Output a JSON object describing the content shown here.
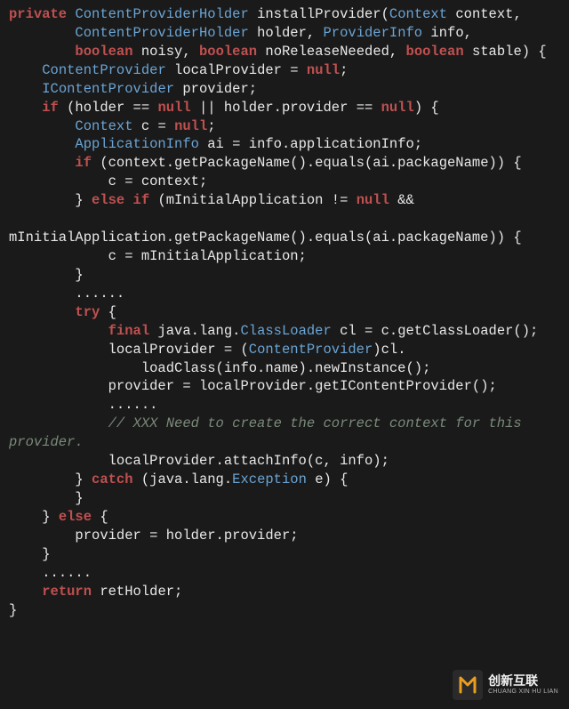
{
  "code": {
    "tokens": [
      {
        "c": "kw",
        "t": "private"
      },
      {
        "c": "txt",
        "t": " "
      },
      {
        "c": "type",
        "t": "ContentProviderHolder"
      },
      {
        "c": "txt",
        "t": " installProvider("
      },
      {
        "c": "type",
        "t": "Context"
      },
      {
        "c": "txt",
        "t": " context,\n"
      },
      {
        "c": "txt",
        "t": "        "
      },
      {
        "c": "type",
        "t": "ContentProviderHolder"
      },
      {
        "c": "txt",
        "t": " holder, "
      },
      {
        "c": "type",
        "t": "ProviderInfo"
      },
      {
        "c": "txt",
        "t": " info,\n"
      },
      {
        "c": "txt",
        "t": "        "
      },
      {
        "c": "kw",
        "t": "boolean"
      },
      {
        "c": "txt",
        "t": " noisy, "
      },
      {
        "c": "kw",
        "t": "boolean"
      },
      {
        "c": "txt",
        "t": " noReleaseNeeded, "
      },
      {
        "c": "kw",
        "t": "boolean"
      },
      {
        "c": "txt",
        "t": " stable) {\n"
      },
      {
        "c": "txt",
        "t": "    "
      },
      {
        "c": "type",
        "t": "ContentProvider"
      },
      {
        "c": "txt",
        "t": " localProvider = "
      },
      {
        "c": "kw",
        "t": "null"
      },
      {
        "c": "txt",
        "t": ";\n"
      },
      {
        "c": "txt",
        "t": "    "
      },
      {
        "c": "type",
        "t": "IContentProvider"
      },
      {
        "c": "txt",
        "t": " provider;\n"
      },
      {
        "c": "txt",
        "t": "    "
      },
      {
        "c": "kw",
        "t": "if"
      },
      {
        "c": "txt",
        "t": " (holder == "
      },
      {
        "c": "kw",
        "t": "null"
      },
      {
        "c": "txt",
        "t": " || holder.provider == "
      },
      {
        "c": "kw",
        "t": "null"
      },
      {
        "c": "txt",
        "t": ") {\n"
      },
      {
        "c": "txt",
        "t": "        "
      },
      {
        "c": "type",
        "t": "Context"
      },
      {
        "c": "txt",
        "t": " c = "
      },
      {
        "c": "kw",
        "t": "null"
      },
      {
        "c": "txt",
        "t": ";\n"
      },
      {
        "c": "txt",
        "t": "        "
      },
      {
        "c": "type",
        "t": "ApplicationInfo"
      },
      {
        "c": "txt",
        "t": " ai = info.applicationInfo;\n"
      },
      {
        "c": "txt",
        "t": "        "
      },
      {
        "c": "kw",
        "t": "if"
      },
      {
        "c": "txt",
        "t": " (context.getPackageName().equals(ai.packageName)) {\n"
      },
      {
        "c": "txt",
        "t": "            c = context;\n"
      },
      {
        "c": "txt",
        "t": "        } "
      },
      {
        "c": "kw",
        "t": "else if"
      },
      {
        "c": "txt",
        "t": " (mInitialApplication != "
      },
      {
        "c": "kw",
        "t": "null"
      },
      {
        "c": "txt",
        "t": " &&\n"
      },
      {
        "c": "txt",
        "t": "\nmInitialApplication.getPackageName().equals(ai.packageName)) {\n"
      },
      {
        "c": "txt",
        "t": "            c = mInitialApplication;\n"
      },
      {
        "c": "txt",
        "t": "        }\n"
      },
      {
        "c": "txt",
        "t": "        ......\n"
      },
      {
        "c": "txt",
        "t": "        "
      },
      {
        "c": "kw",
        "t": "try"
      },
      {
        "c": "txt",
        "t": " {\n"
      },
      {
        "c": "txt",
        "t": "            "
      },
      {
        "c": "kw",
        "t": "final"
      },
      {
        "c": "txt",
        "t": " java.lang."
      },
      {
        "c": "type",
        "t": "ClassLoader"
      },
      {
        "c": "txt",
        "t": " cl = c.getClassLoader();\n"
      },
      {
        "c": "txt",
        "t": "            localProvider = ("
      },
      {
        "c": "type",
        "t": "ContentProvider"
      },
      {
        "c": "txt",
        "t": ")cl.\n"
      },
      {
        "c": "txt",
        "t": "                loadClass(info.name).newInstance();\n"
      },
      {
        "c": "txt",
        "t": "            provider = localProvider.getIContentProvider();\n"
      },
      {
        "c": "txt",
        "t": "            ......\n"
      },
      {
        "c": "txt",
        "t": "            "
      },
      {
        "c": "cmt",
        "t": "// XXX Need to create the correct context for this provider."
      },
      {
        "c": "txt",
        "t": "\n"
      },
      {
        "c": "txt",
        "t": "            localProvider.attachInfo(c, info);\n"
      },
      {
        "c": "txt",
        "t": "        } "
      },
      {
        "c": "kw",
        "t": "catch"
      },
      {
        "c": "txt",
        "t": " (java.lang."
      },
      {
        "c": "type",
        "t": "Exception"
      },
      {
        "c": "txt",
        "t": " e) {\n"
      },
      {
        "c": "txt",
        "t": "        }\n"
      },
      {
        "c": "txt",
        "t": "    } "
      },
      {
        "c": "kw",
        "t": "else"
      },
      {
        "c": "txt",
        "t": " {\n"
      },
      {
        "c": "txt",
        "t": "        provider = holder.provider;\n"
      },
      {
        "c": "txt",
        "t": "    }\n"
      },
      {
        "c": "txt",
        "t": "    ......\n"
      },
      {
        "c": "txt",
        "t": "    "
      },
      {
        "c": "kw",
        "t": "return"
      },
      {
        "c": "txt",
        "t": " retHolder;\n"
      },
      {
        "c": "txt",
        "t": "}"
      }
    ]
  },
  "watermark": {
    "cn": "创新互联",
    "py": "CHUANG XIN HU LIAN",
    "logo_color": "#f5a623"
  }
}
